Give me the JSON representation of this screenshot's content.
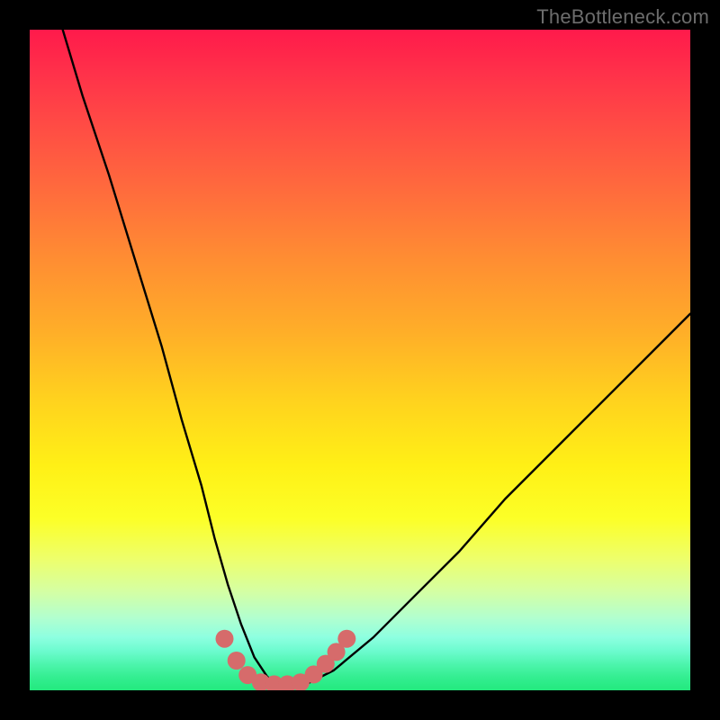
{
  "watermark": "TheBottleneck.com",
  "colors": {
    "curve": "#000000",
    "dots": "#d66b6b",
    "frame": "#000000"
  },
  "chart_data": {
    "type": "line",
    "title": "",
    "xlabel": "",
    "ylabel": "",
    "xlim": [
      0,
      100
    ],
    "ylim": [
      0,
      100
    ],
    "grid": false,
    "legend": false,
    "series": [
      {
        "name": "bottleneck-curve",
        "x": [
          5,
          8,
          12,
          16,
          20,
          23,
          26,
          28,
          30,
          32,
          34,
          36,
          38,
          42,
          46,
          52,
          58,
          65,
          72,
          80,
          88,
          96,
          100
        ],
        "y": [
          100,
          90,
          78,
          65,
          52,
          41,
          31,
          23,
          16,
          10,
          5,
          2,
          1,
          1,
          3,
          8,
          14,
          21,
          29,
          37,
          45,
          53,
          57
        ]
      }
    ],
    "markers": [
      {
        "name": "highlight-dot",
        "x": 29.5,
        "y": 7.8
      },
      {
        "name": "highlight-dot",
        "x": 31.3,
        "y": 4.5
      },
      {
        "name": "highlight-dot",
        "x": 33.0,
        "y": 2.3
      },
      {
        "name": "highlight-dot",
        "x": 35.0,
        "y": 1.2
      },
      {
        "name": "highlight-dot",
        "x": 37.0,
        "y": 0.9
      },
      {
        "name": "highlight-dot",
        "x": 39.0,
        "y": 0.9
      },
      {
        "name": "highlight-dot",
        "x": 41.0,
        "y": 1.2
      },
      {
        "name": "highlight-dot",
        "x": 43.0,
        "y": 2.4
      },
      {
        "name": "highlight-dot",
        "x": 44.8,
        "y": 4.0
      },
      {
        "name": "highlight-dot",
        "x": 46.4,
        "y": 5.8
      },
      {
        "name": "highlight-dot",
        "x": 48.0,
        "y": 7.8
      }
    ],
    "gradient_stops": [
      {
        "pos": 0,
        "color": "#ff1a4b"
      },
      {
        "pos": 34,
        "color": "#ff8b33"
      },
      {
        "pos": 66,
        "color": "#fff016"
      },
      {
        "pos": 100,
        "color": "#23e97e"
      }
    ]
  }
}
